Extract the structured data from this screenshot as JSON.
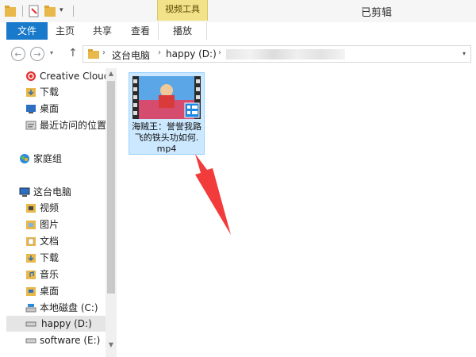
{
  "titlebar": {
    "context_tab_label": "视频工具",
    "window_title": "已剪辑"
  },
  "ribbon": {
    "tabs": {
      "file": "文件",
      "home": "主页",
      "share": "共享",
      "view": "查看",
      "play": "播放"
    }
  },
  "address": {
    "crumbs": [
      "这台电脑",
      "happy (D:)"
    ]
  },
  "nav_pane": {
    "items": [
      {
        "label": "Creative Cloud",
        "icon": "creative-cloud-icon"
      },
      {
        "label": "下载",
        "icon": "downloads-folder-icon"
      },
      {
        "label": "桌面",
        "icon": "desktop-icon"
      },
      {
        "label": "最近访问的位置",
        "icon": "recent-places-icon"
      },
      {
        "label": "家庭组",
        "icon": "homegroup-icon"
      },
      {
        "label": "这台电脑",
        "icon": "this-pc-icon"
      },
      {
        "label": "视频",
        "icon": "videos-folder-icon"
      },
      {
        "label": "图片",
        "icon": "pictures-folder-icon"
      },
      {
        "label": "文档",
        "icon": "documents-folder-icon"
      },
      {
        "label": "下载",
        "icon": "downloads-folder-icon"
      },
      {
        "label": "音乐",
        "icon": "music-folder-icon"
      },
      {
        "label": "桌面",
        "icon": "desktop-folder-icon"
      },
      {
        "label": "本地磁盘 (C:)",
        "icon": "windows-drive-icon"
      },
      {
        "label": "happy (D:)",
        "icon": "drive-icon"
      },
      {
        "label": "software (E:)",
        "icon": "drive-icon"
      }
    ]
  },
  "content": {
    "file": {
      "name": "海贼王：誉誉我路飞的铁头功如何.mp4",
      "type_icon": "video-file-icon"
    }
  },
  "colors": {
    "file_tab": "#1979ca",
    "context_tab": "#f2e28a",
    "selection": "#cce8ff",
    "annotation_arrow": "#f23b3b"
  }
}
